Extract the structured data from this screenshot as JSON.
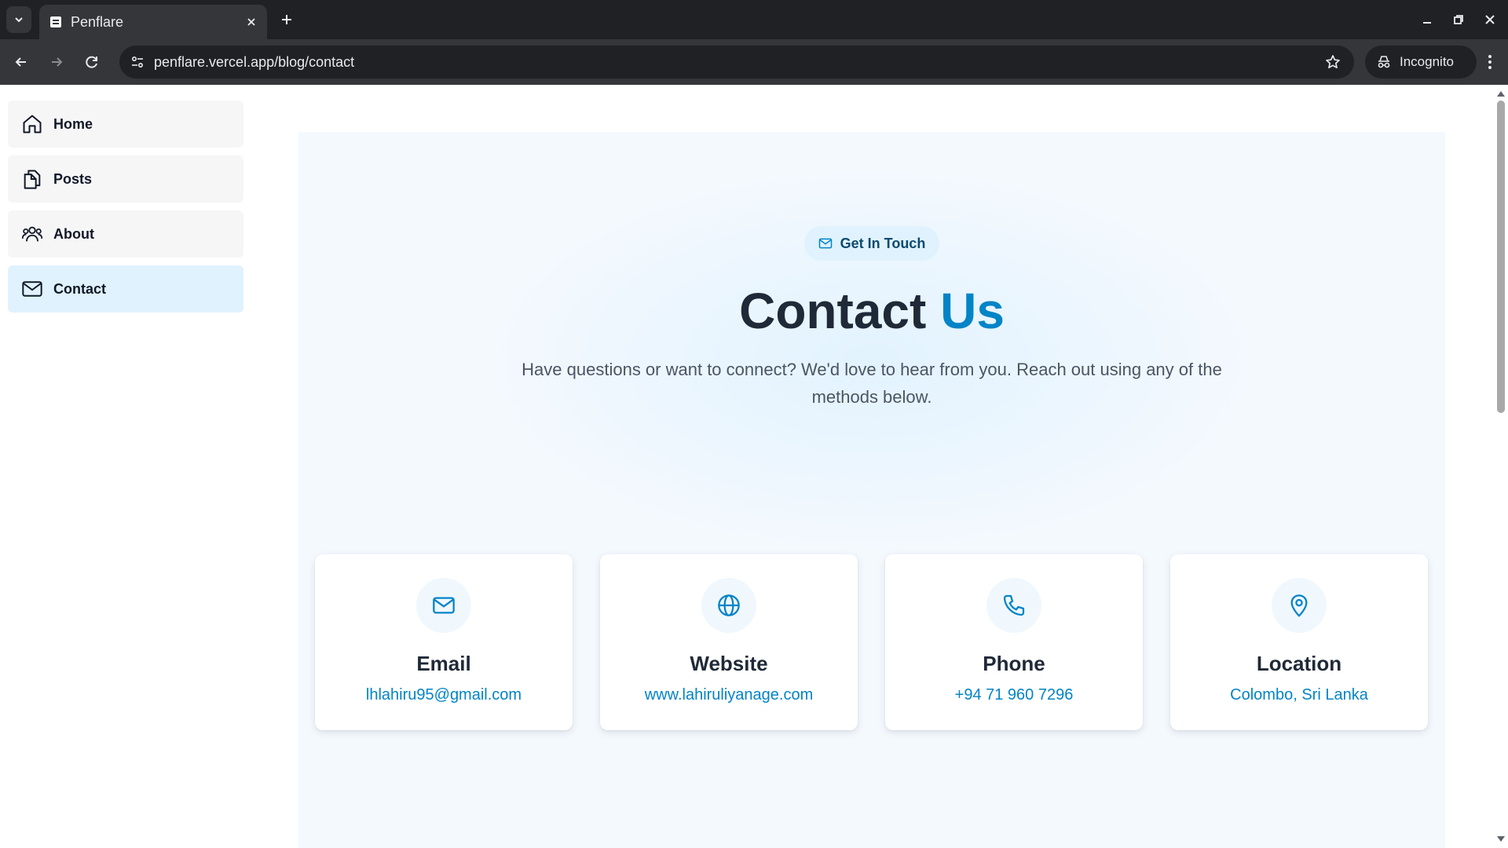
{
  "browser": {
    "tab_title": "Penflare",
    "url": "penflare.vercel.app/blog/contact",
    "incognito_label": "Incognito"
  },
  "sidebar": {
    "items": [
      {
        "label": "Home",
        "icon": "home-icon",
        "active": false
      },
      {
        "label": "Posts",
        "icon": "documents-icon",
        "active": false
      },
      {
        "label": "About",
        "icon": "users-icon",
        "active": false
      },
      {
        "label": "Contact",
        "icon": "mail-icon",
        "active": true
      }
    ]
  },
  "hero": {
    "badge": "Get In Touch",
    "heading_main": "Contact ",
    "heading_accent": "Us",
    "subtitle": "Have questions or want to connect? We'd love to hear from you. Reach out using any of the methods below."
  },
  "cards": [
    {
      "title": "Email",
      "value": "lhlahiru95@gmail.com",
      "icon": "mail-icon"
    },
    {
      "title": "Website",
      "value": "www.lahiruliyanage.com",
      "icon": "globe-icon"
    },
    {
      "title": "Phone",
      "value": "+94 71 960 7296",
      "icon": "phone-icon"
    },
    {
      "title": "Location",
      "value": "Colombo, Sri Lanka",
      "icon": "map-pin-icon"
    }
  ],
  "colors": {
    "accent": "#0284c7",
    "active_nav_bg": "#e0f2fe",
    "hero_bg": "#f4f9fe",
    "chrome_dark": "#202124",
    "chrome_toolbar": "#35363a"
  }
}
